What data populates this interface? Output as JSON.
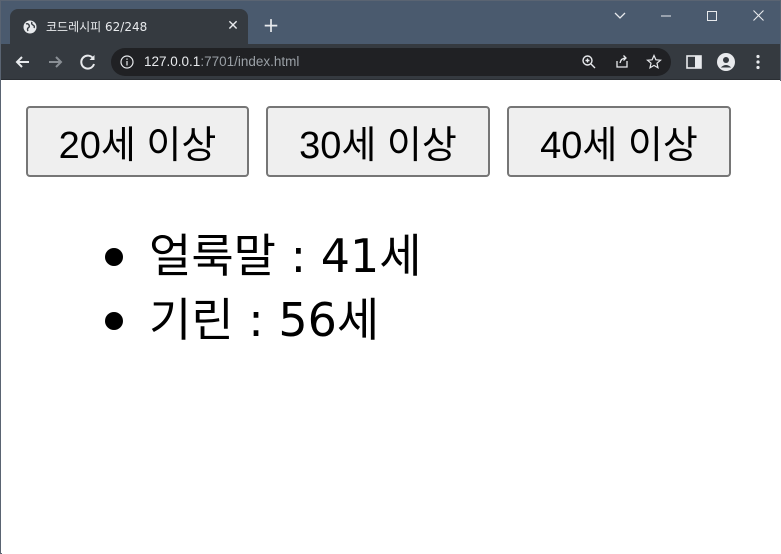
{
  "browser": {
    "tab_title": "코드레시피 62/248",
    "url_host": "127.0.0.1",
    "url_rest": ":7701/index.html"
  },
  "filters": [
    {
      "label": "20세 이상"
    },
    {
      "label": "30세 이상"
    },
    {
      "label": "40세 이상"
    }
  ],
  "animals": [
    {
      "text": "얼룩말 : 41세"
    },
    {
      "text": "기린 : 56세"
    }
  ]
}
